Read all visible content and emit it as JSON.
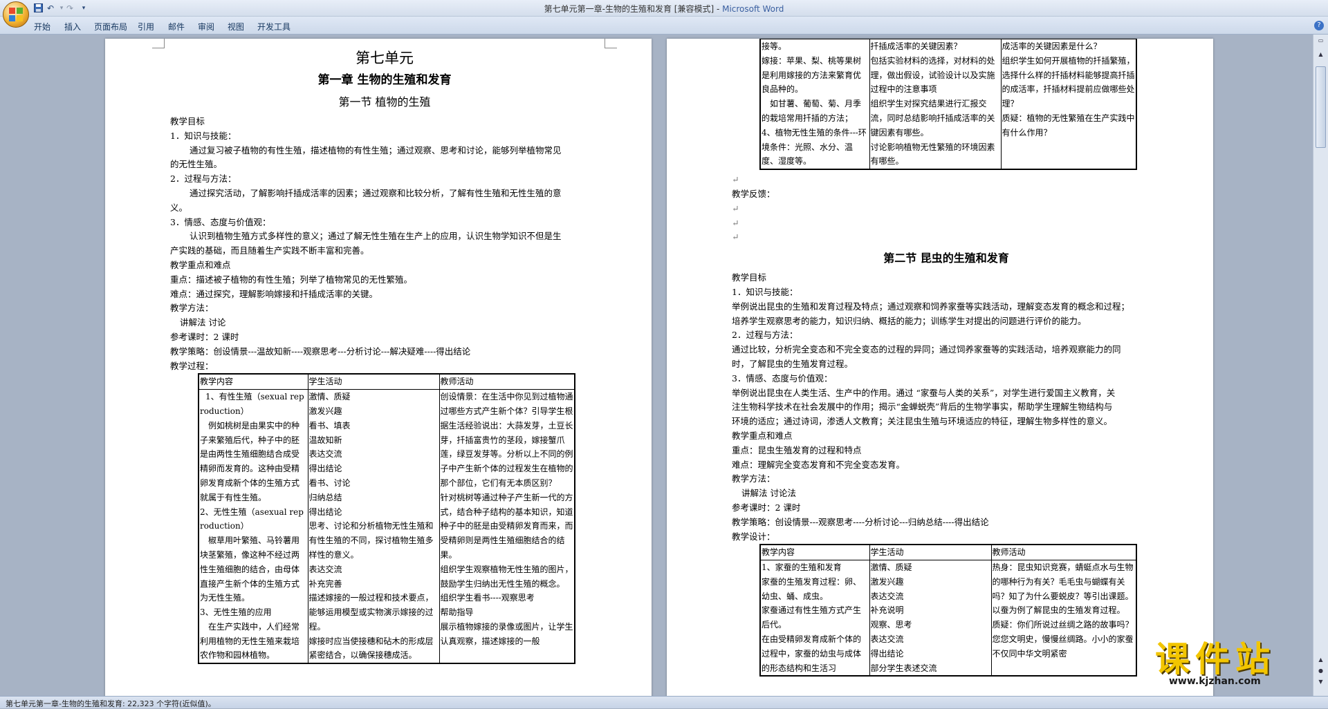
{
  "window": {
    "title": "第七单元第一章-生物的生殖和发育 [兼容模式] - ",
    "app": "Microsoft Word"
  },
  "ribbon": {
    "tabs": [
      "开始",
      "插入",
      "页面布局",
      "引用",
      "邮件",
      "审阅",
      "视图",
      "开发工具"
    ]
  },
  "status": {
    "text": "第七单元第一章-生物的生殖和发育: 22,323 个字符(近似值)。"
  },
  "watermark": {
    "cn": "课件站",
    "url": "www.kjzhan.com"
  },
  "page1": {
    "unit": "第七单元",
    "chapter": "第一章 生物的生殖和发育",
    "section": "第一节 植物的生殖",
    "lines": [
      "教学目标",
      "1．知识与技能：",
      "通过复习被子植物的有性生殖，描述植物的有性生殖；通过观察、思考和讨论，能够列举植物常见",
      "的无性生殖。",
      "2．过程与方法：",
      "通过探究活动，了解影响扦插成活率的因素；通过观察和比较分析，了解有性生殖和无性生殖的意",
      "义。",
      "3．情感、态度与价值观：",
      "认识到植物生殖方式多样性的意义；通过了解无性生殖在生产上的应用，认识生物学知识不但是生",
      "产实践的基础，而且随着生产实践不断丰富和完善。",
      "教学重点和难点",
      "重点：描述被子植物的有性生殖；列举了植物常见的无性繁殖。",
      "难点：通过探究，理解影响嫁接和扦插成活率的关键。",
      "教学方法：",
      "讲解法 讨论",
      "参考课时：2 课时",
      "教学策略：创设情景---温故知新----观察思考---分析讨论---解决疑难----得出结论",
      "教学过程："
    ],
    "table": {
      "headers": [
        "教学内容",
        "学生活动",
        "教师活动"
      ],
      "col1": [
        "1、有性生殖（sexual reproduction）",
        "例如桃树是由果实中的种子来繁殖后代，种子中的胚是由两性生殖细胞结合成受精卵而发育的。这种由受精卵发育成新个体的生殖方式就属于有性生殖。",
        "2、无性生殖（asexual reproduction）",
        "椒草用叶繁殖、马铃薯用块茎繁殖，像这种不经过两性生殖细胞的结合，由母体直接产生新个体的生殖方式为无性生殖。",
        "3、无性生殖的应用",
        "在生产实践中，人们经常利用植物的无性生殖来栽培农作物和园林植物。"
      ],
      "col2": [
        "激情、质疑",
        "激发兴趣",
        "看书、填表",
        "温故知新",
        "表达交流",
        "得出结论",
        "看书、讨论",
        "归纳总结",
        "得出结论",
        "思考、讨论和分析植物无性生殖和有性生殖的不同，探讨植物生殖多样性的意义。",
        "表达交流",
        "补充完善",
        "描述嫁接的一般过程和技术要点，能够运用模型或实物演示嫁接的过程。",
        "嫁接时应当使接穗和砧木的形成层紧密结合，以确保接穗成活。"
      ],
      "col3": [
        "创设情景：在生活中你见到过植物通过哪些方式产生新个体？引导学生根据生活经验说出：大蒜发芽，土豆长芽，扦插富贵竹的茎段，嫁接蟹爪莲，绿豆发芽等。分析以上不同的例子中产生新个体的过程发生在植物的那个部位，它们有无本质区别？",
        "针对桃树等通过种子产生新一代的方式，结合种子结构的基本知识，知道种子中的胚是由受精卵发育而来，而受精卵则是两性生殖细胞结合的结果。",
        "组织学生观察植物无性生殖的图片，鼓励学生归纳出无性生殖的概念。",
        "组织学生看书----观察思考",
        "帮助指导",
        "展示植物嫁接的录像或图片，让学生认真观察，描述嫁接的一般"
      ]
    }
  },
  "page2": {
    "table": {
      "col1": [
        "接等。",
        "嫁接：苹果、梨、桃等果树是利用嫁接的方法来繁育优良品种的。",
        "如甘薯、葡萄、菊、月季的栽培常用扦插的方法；",
        "4、植物无性生殖的条件---环境条件：光照、水分、温度、湿度等。"
      ],
      "col2": [
        "扦插成活率的关键因素？",
        "包括实验材料的选择，对材料的处理，做出假设，试验设计以及实施过程中的注意事项",
        "组织学生对探究结果进行汇报交流，同时总结影响扦插成活率的关键因素有哪些。",
        "讨论影响植物无性繁殖的环境因素有哪些。"
      ],
      "col3": [
        "成活率的关键因素是什么？",
        "组织学生如何开展植物的扦插繁殖，选择什么样的扦插材料能够提高扦插的成活率，扦插材料提前应做哪些处理？",
        "质疑：植物的无性繁殖在生产实践中有什么作用？"
      ]
    },
    "feedback": "教学反馈：",
    "section": "第二节 昆虫的生殖和发育",
    "lines": [
      "教学目标",
      "1．知识与技能：",
      "举例说出昆虫的生殖和发育过程及特点；通过观察和饲养家蚕等实践活动，理解变态发育的概念和过程；",
      "培养学生观察思考的能力，知识归纳、概括的能力；训练学生对提出的问题进行评价的能力。",
      "2．过程与方法：",
      "通过比较，分析完全变态和不完全变态的过程的异同；通过饲养家蚕等的实践活动，培养观察能力的同",
      "时，了解昆虫的生殖发育过程。",
      "3．情感、态度与价值观：",
      "举例说出昆虫在人类生活、生产中的作用。通过 “家蚕与人类的关系”，对学生进行爱国主义教育，关",
      "注生物科学技术在社会发展中的作用；揭示“金蝉蜕壳”背后的生物学事实，帮助学生理解生物结构与",
      "环境的适应；通过诗词，渗透人文教育；关注昆虫生殖与环境适应的特征，理解生物多样性的意义。",
      "教学重点和难点",
      "重点：昆虫生殖发育的过程和特点",
      "难点：理解完全变态发育和不完全变态发育。",
      "教学方法：",
      "讲解法 讨论法",
      "参考课时：2 课时",
      "教学策略：创设情景---观察思考----分析讨论---归纳总结----得出结论",
      "教学设计："
    ],
    "table2": {
      "headers": [
        "教学内容",
        "学生活动",
        "教师活动"
      ],
      "col1": [
        "1、家蚕的生殖和发育",
        "家蚕的生殖发育过程：卵、幼虫、蛹、成虫。",
        "家蚕通过有性生殖方式产生后代。",
        "在由受精卵发育成新个体的过程中，家蚕的幼虫与成体的形态结构和生活习"
      ],
      "col2": [
        "激情、质疑",
        "激发兴趣",
        "表达交流",
        "补充说明",
        "观察、思考",
        "表达交流",
        "得出结论",
        "部分学生表述交流"
      ],
      "col3": [
        "热身：昆虫知识竞赛，蜻蜓点水与生物的哪种行为有关？毛毛虫与蝴蝶有关吗？知了为什么要蜕皮？等引出课题。以蚕为例了解昆虫的生殖发育过程。",
        "质疑：你们所说过丝绸之路的故事吗？您您文明史，慢慢丝绸路。小小的家蚕不仅同中华文明紧密"
      ]
    }
  }
}
